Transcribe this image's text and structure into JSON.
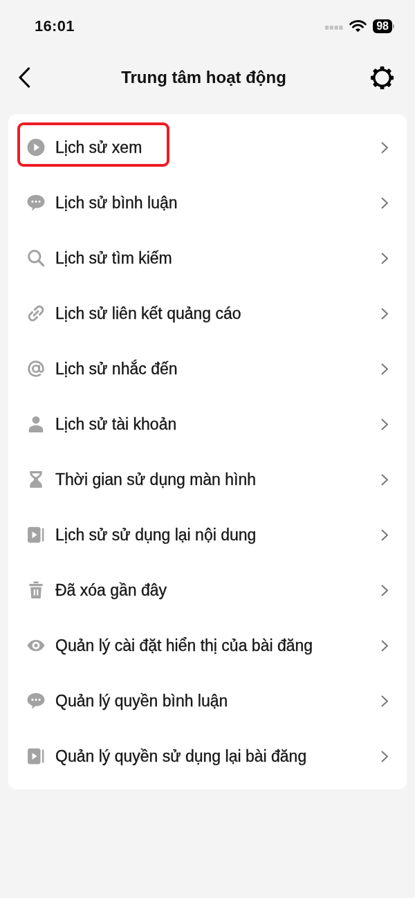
{
  "status_bar": {
    "time": "16:01",
    "battery": "98"
  },
  "header": {
    "title": "Trung tâm hoạt động"
  },
  "items": [
    {
      "label": "Lịch sử xem",
      "kind": "play",
      "highlighted": true
    },
    {
      "label": "Lịch sử bình luận",
      "kind": "comment",
      "highlighted": false
    },
    {
      "label": "Lịch sử tìm kiếm",
      "kind": "search",
      "highlighted": false
    },
    {
      "label": "Lịch sử liên kết quảng cáo",
      "kind": "link",
      "highlighted": false
    },
    {
      "label": "Lịch sử nhắc đến",
      "kind": "mention",
      "highlighted": false
    },
    {
      "label": "Lịch sử tài khoản",
      "kind": "account",
      "highlighted": false
    },
    {
      "label": "Thời gian sử dụng màn hình",
      "kind": "hourglass",
      "highlighted": false
    },
    {
      "label": "Lịch sử sử dụng lại nội dung",
      "kind": "reuse",
      "highlighted": false
    },
    {
      "label": "Đã xóa gần đây",
      "kind": "trash",
      "highlighted": false
    },
    {
      "label": "Quản lý cài đặt hiển thị của bài đăng",
      "kind": "eye",
      "highlighted": false
    },
    {
      "label": "Quản lý quyền bình luận",
      "kind": "comment",
      "highlighted": false
    },
    {
      "label": "Quản lý quyền sử dụng lại bài đăng",
      "kind": "reuse",
      "highlighted": false
    }
  ]
}
